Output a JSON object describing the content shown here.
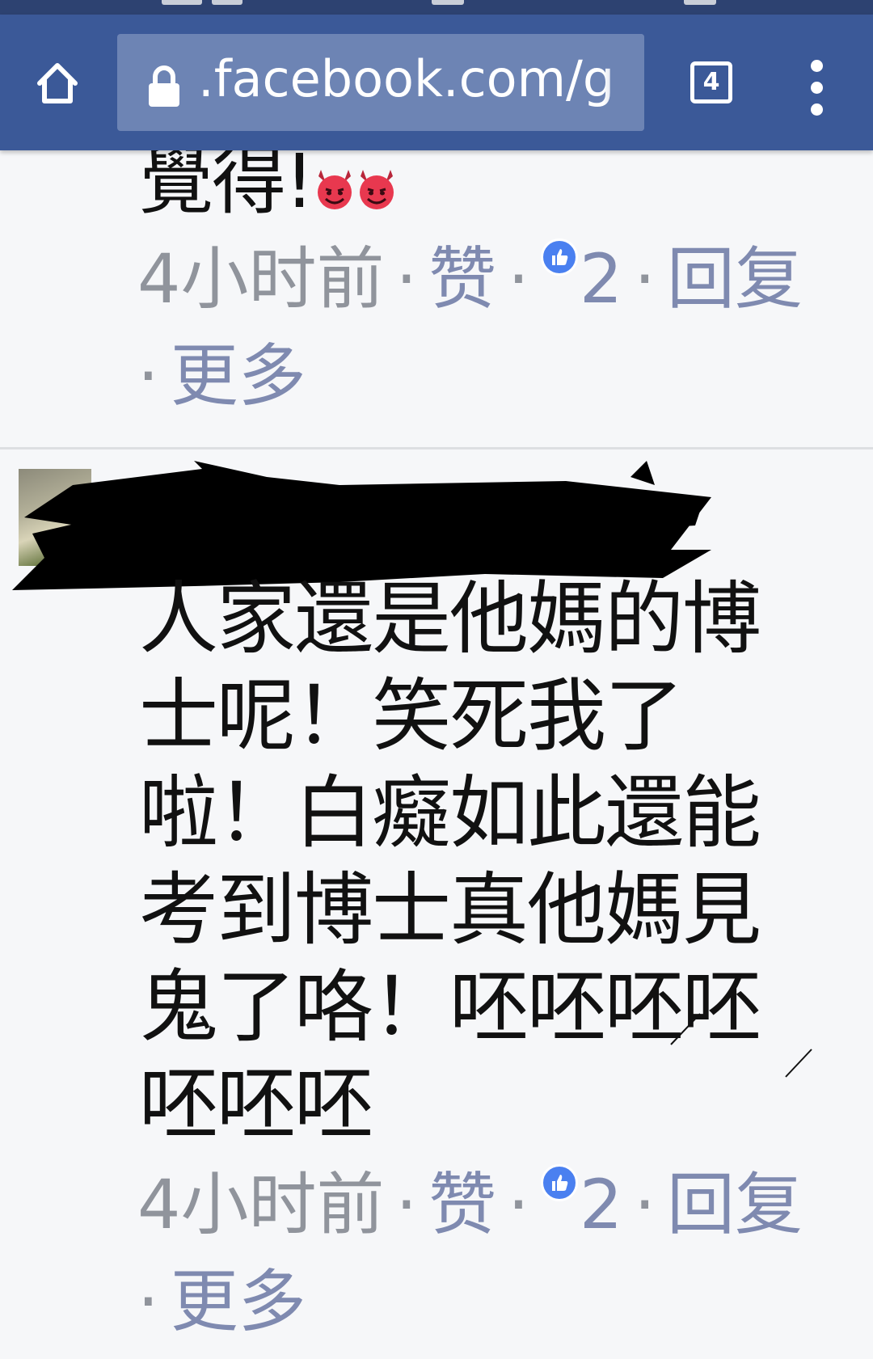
{
  "toolbar": {
    "url": ".facebook.com/g",
    "tab_count": "4",
    "accent": "#3b5998"
  },
  "comment_top": {
    "text_tail": "覺得!",
    "emojis": [
      "smiling-imp-icon",
      "smiling-imp-icon"
    ],
    "time": "4小时前",
    "like_label": "赞",
    "like_count": "2",
    "reply_label": "回复",
    "more_label": "更多"
  },
  "comment_main": {
    "author_name_redacted": true,
    "lines": [
      "人家還是他媽的博",
      "士呢！笑死我了",
      "啦！白癡如此還能",
      "考到博士真他媽見",
      "鬼了咯！呸呸呸呸",
      "呸呸呸"
    ],
    "time": "4小时前",
    "like_label": "赞",
    "like_count": "2",
    "reply_label": "回复",
    "more_label": "更多"
  },
  "separator_dot": "·"
}
